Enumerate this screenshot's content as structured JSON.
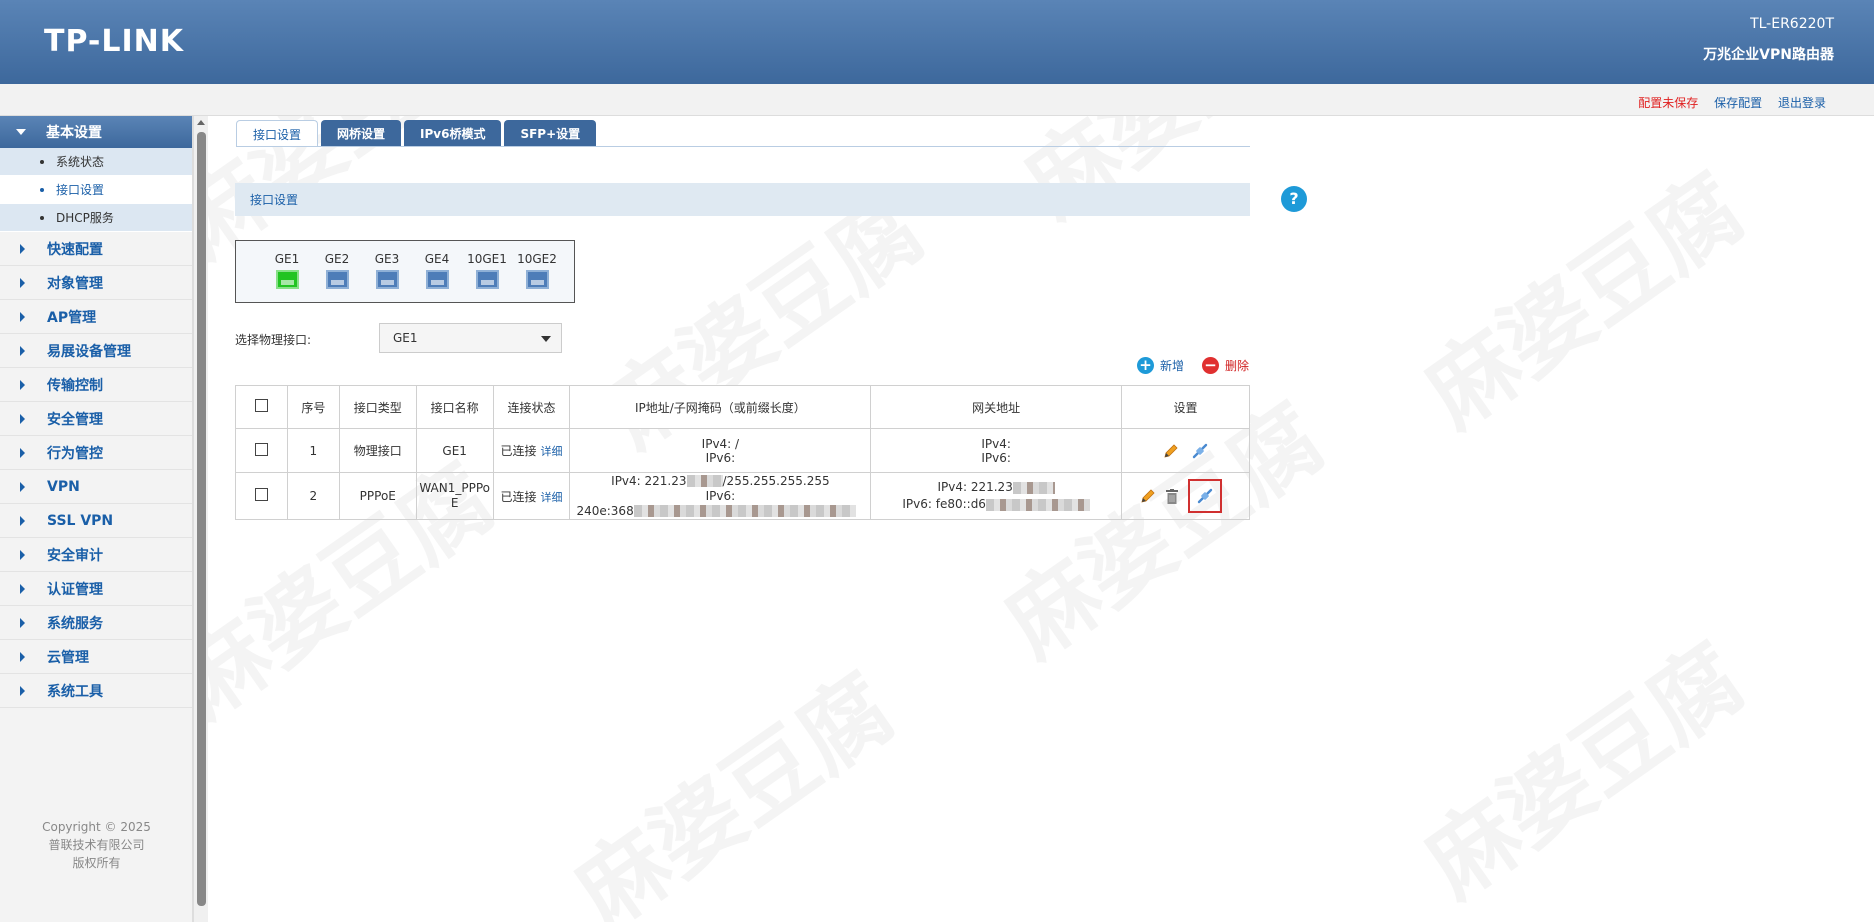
{
  "header": {
    "logo": "TP-LINK",
    "model": "TL-ER6220T",
    "subtitle": "万兆企业VPN路由器"
  },
  "toplinks": {
    "unsaved": "配置未保存",
    "save": "保存配置",
    "logout": "退出登录"
  },
  "sidebar": {
    "expanded": {
      "label": "基本设置",
      "children": [
        "系统状态",
        "接口设置",
        "DHCP服务"
      ],
      "active": "接口设置"
    },
    "items": [
      "快速配置",
      "对象管理",
      "AP管理",
      "易展设备管理",
      "传输控制",
      "安全管理",
      "行为管控",
      "VPN",
      "SSL VPN",
      "安全审计",
      "认证管理",
      "系统服务",
      "云管理",
      "系统工具"
    ],
    "copyright": [
      "Copyright © 2025",
      "普联技术有限公司",
      "版权所有"
    ]
  },
  "tabs": [
    "接口设置",
    "网桥设置",
    "IPv6桥模式",
    "SFP+设置"
  ],
  "active_tab": "接口设置",
  "section_title": "接口设置",
  "help_icon": "?",
  "ports": [
    {
      "label": "GE1",
      "status": "up"
    },
    {
      "label": "GE2",
      "status": "down"
    },
    {
      "label": "GE3",
      "status": "down"
    },
    {
      "label": "GE4",
      "status": "down"
    },
    {
      "label": "10GE1",
      "status": "down"
    },
    {
      "label": "10GE2",
      "status": "down"
    }
  ],
  "physical_select": {
    "label": "选择物理接口:",
    "value": "GE1"
  },
  "actions": {
    "add": "新增",
    "delete": "删除"
  },
  "table": {
    "columns": [
      "序号",
      "接口类型",
      "接口名称",
      "连接状态",
      "IP地址/子网掩码（或前缀长度）",
      "网关地址",
      "设置"
    ],
    "detail_link": "详细",
    "rows": [
      {
        "no": "1",
        "type": "物理接口",
        "name": "GE1",
        "status": "已连接",
        "ip_v4": "IPv4:  /",
        "ip_v6": "IPv6:",
        "gw_v4": "IPv4:",
        "gw_v6": "IPv6:"
      },
      {
        "no": "2",
        "type": "PPPoE",
        "name": "WAN1_PPPoE",
        "status": "已连接",
        "ip_v4_prefix": "IPv4:  221.23",
        "ip_v4_suffix": "/255.255.255.255",
        "ip_v6": "IPv6:",
        "ip_v6_prefix": "240e:368",
        "gw_v4": "IPv4:  221.23",
        "gw_v6": "IPv6:  fe80::d6"
      }
    ]
  },
  "watermark": "麻婆豆腐",
  "colors": {
    "header_blue": "#3d689c",
    "link_blue": "#1a5fa8",
    "port_up": "#22c422",
    "alert_red": "#e02020"
  }
}
